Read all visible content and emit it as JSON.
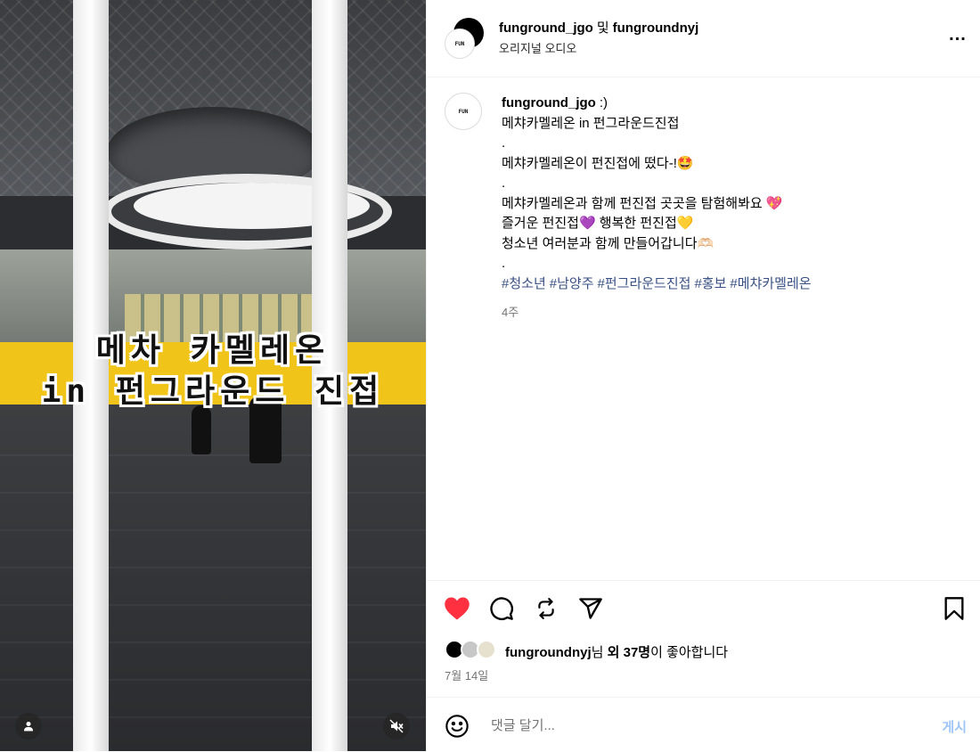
{
  "media": {
    "overlay_line1": "메차 카멜레온",
    "overlay_line2": "in 펀그라운드 진접"
  },
  "header": {
    "author": "funground_jgo",
    "conjunction": "및",
    "coauthor": "fungroundnyj",
    "audio": "오리지널 오디오",
    "more": "..."
  },
  "post": {
    "username": "funground_jgo",
    "caption": ":)\n메챠카멜레온 in 펀그라운드진접\n.\n메챠카멜레온이 펀진접에 떴다-!🤩\n.\n메챠카멜레온과 함께 펀진접 곳곳을 탐험해봐요 💖\n즐거운 펀진접💜 행복한 펀진접💛\n청소년 여러분과 함께 만들어갑니다🫶🏻\n.",
    "hashtags": [
      "#청소년",
      "#남양주",
      "#펀그라운드진접",
      "#홍보",
      "#메챠카멜레온"
    ],
    "time_ago": "4주"
  },
  "likes": {
    "liker": "fungroundnyj",
    "suffix1": "님",
    "others": "외 37명",
    "suffix2": "이 좋아합니다"
  },
  "date": "7월 14일",
  "comment": {
    "placeholder": "댓글 달기...",
    "post_label": "게시"
  },
  "colors": {
    "like_red": "#ff3040",
    "link_blue": "#385185",
    "post_button": "#9ec5f8"
  }
}
